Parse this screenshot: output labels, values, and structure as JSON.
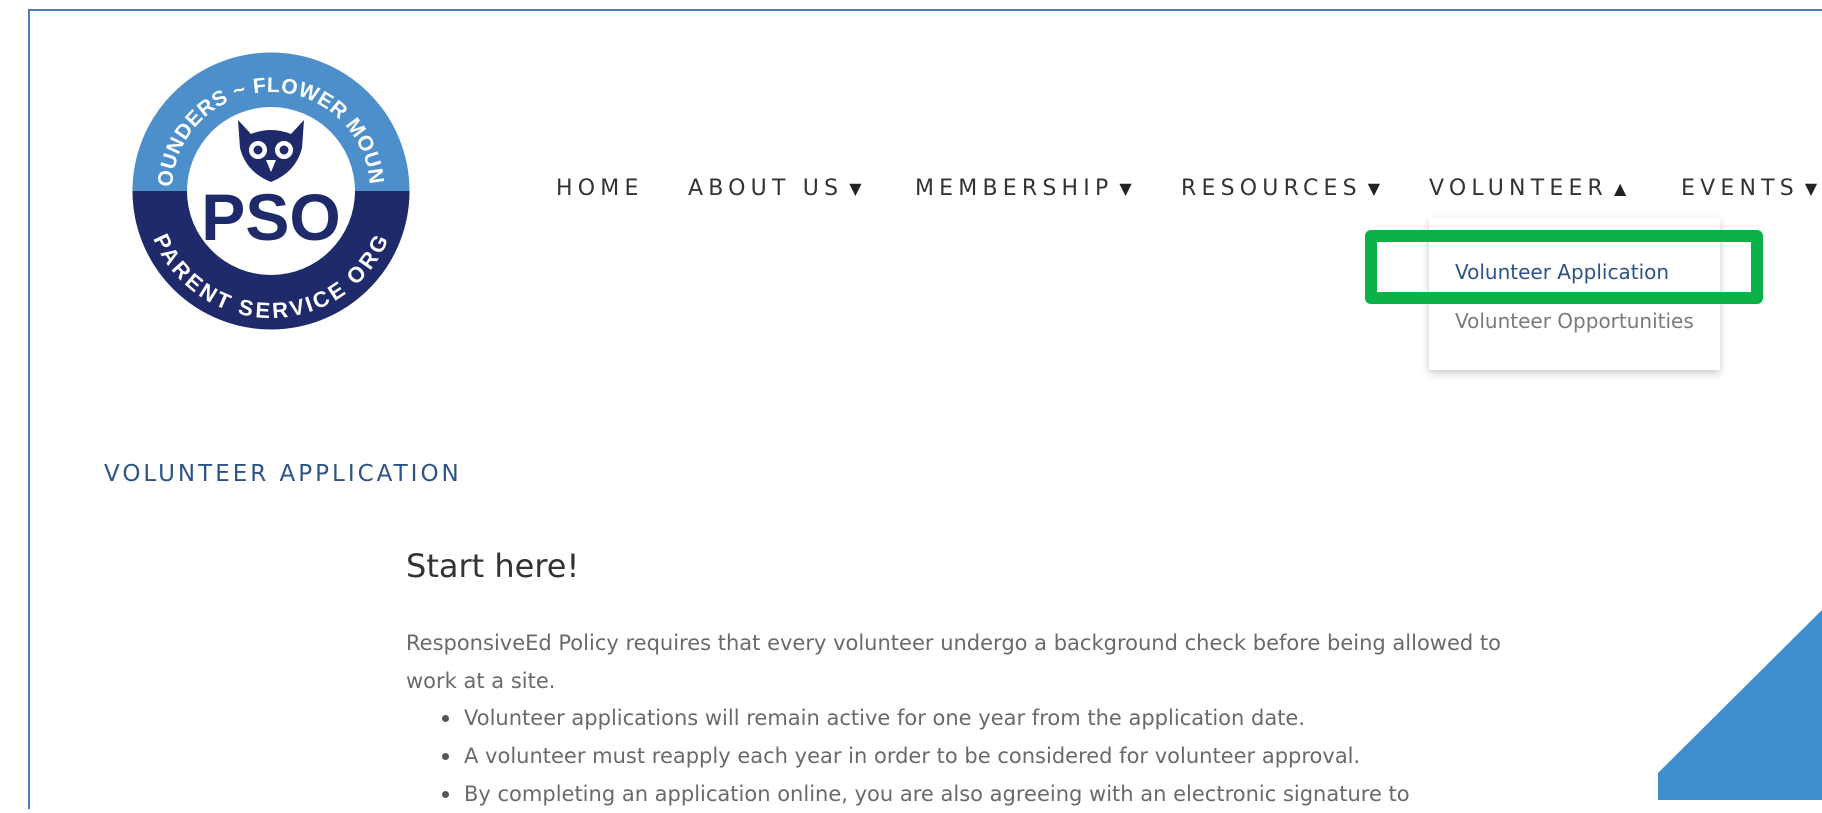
{
  "logo": {
    "top_text": "FOUNDERS ~ FLOWER MOUND",
    "center_text": "PSO",
    "bottom_text": "PARENT SERVICE ORG",
    "colors": {
      "outer_ring": "#4c8fcb",
      "lower_ring": "#1f2a6b",
      "text": "#ffffff"
    }
  },
  "nav": {
    "items": [
      {
        "label": "HOME",
        "caret": ""
      },
      {
        "label": "ABOUT US",
        "caret": "▼"
      },
      {
        "label": "MEMBERSHIP",
        "caret": "▼"
      },
      {
        "label": "RESOURCES",
        "caret": "▼"
      },
      {
        "label": "VOLUNTEER",
        "caret": "▲"
      },
      {
        "label": "EVENTS",
        "caret": "▼"
      }
    ]
  },
  "dropdown": {
    "items": [
      {
        "label": "Volunteer Application",
        "active": true
      },
      {
        "label": "Volunteer Opportunities",
        "active": false
      }
    ]
  },
  "page": {
    "heading": "VOLUNTEER APPLICATION",
    "section_title": "Start here!",
    "intro": "ResponsiveEd Policy requires that every volunteer undergo a background check before being allowed to work at a site.",
    "bullets": [
      "Volunteer applications will remain active for one year from the application date.",
      "A volunteer must reapply each year in order to be considered for volunteer approval.",
      "By completing an application online, you are also agreeing with an electronic signature to"
    ]
  },
  "colors": {
    "accent_blue": "#2d5486",
    "highlight_green": "#0bb24a",
    "corner_blue": "#3f8fd0",
    "frame_border": "#4a7cc0"
  }
}
